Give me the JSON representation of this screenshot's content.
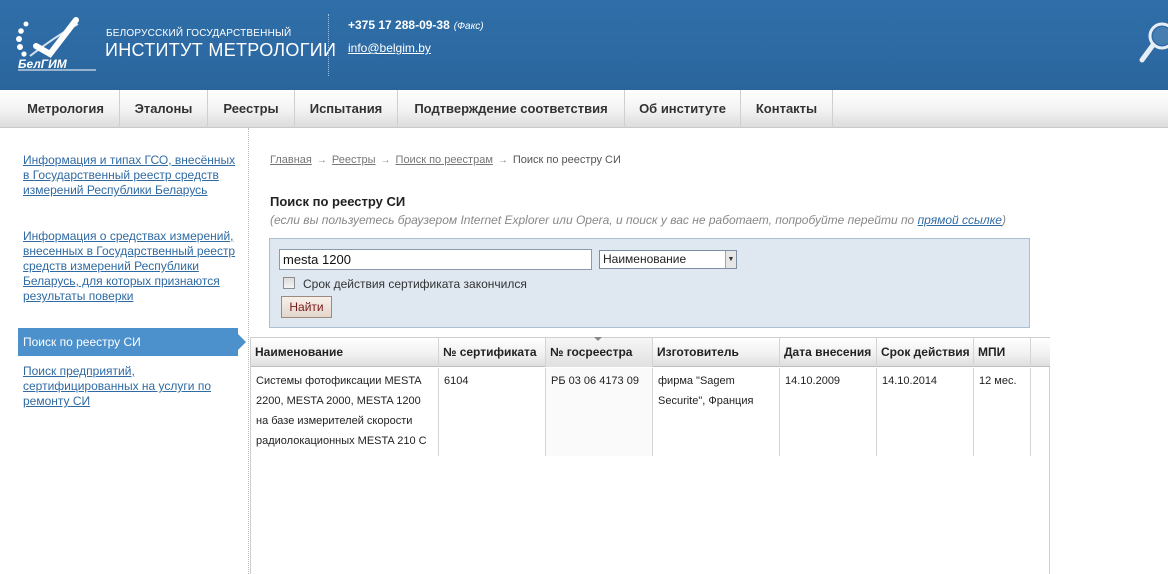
{
  "header": {
    "logo_text": "БелГИМ",
    "org_line1": "БЕЛОРУССКИЙ ГОСУДАРСТВЕННЫЙ",
    "org_line2": "ИНСТИТУТ МЕТРОЛОГИИ",
    "phone": "+375 17 288-09-38",
    "phone_note": "(Факс)",
    "email": "info@belgim.by"
  },
  "nav": {
    "items": [
      {
        "label": "Метрология"
      },
      {
        "label": "Эталоны"
      },
      {
        "label": "Реестры"
      },
      {
        "label": "Испытания"
      },
      {
        "label": "Подтверждение соответствия"
      },
      {
        "label": "Об институте"
      },
      {
        "label": "Контакты"
      }
    ]
  },
  "sidebar": {
    "items": [
      {
        "label": "Информация и типах ГСО, внесённых в Государственный реестр средств измерений Республики Беларусь"
      },
      {
        "label": "Информация о средствах измерений, внесенных в Государственный реестр средств измерений Республики Беларусь, для которых признаются результаты поверки"
      },
      {
        "label": "Поиск по реестру СИ",
        "active": true
      },
      {
        "label": "Поиск предприятий, сертифицированных на услуги по ремонту СИ"
      }
    ]
  },
  "breadcrumb": {
    "items": [
      "Главная",
      "Реестры",
      "Поиск по реестрам"
    ],
    "current": "Поиск по реестру СИ"
  },
  "main": {
    "title": "Поиск по реестру СИ",
    "note_before": "(если вы пользуетесь браузером Internet Explorer или Opera, и поиск у вас не работает, попробуйте перейти по",
    "note_link": "прямой ссылке",
    "note_after": ")"
  },
  "search": {
    "query": "mesta 1200",
    "field_selected": "Наименование",
    "expired_label": "Срок действия сертификата закончился",
    "expired_checked": false,
    "button_label": "Найти"
  },
  "results": {
    "columns": [
      "Наименование",
      "№ сертификата",
      "№ госреестра",
      "Изготовитель",
      "Дата внесения",
      "Срок действия",
      "МПИ"
    ],
    "sorted_column": "№ госреестра",
    "rows": [
      {
        "name": "Системы фотофиксации MESTA 2200, MESTA 2000, MESTA 1200 на базе измерителей скорости радиолокационных MESTA 210 C",
        "certificate": "6104",
        "registry": "РБ 03 06 4173 09",
        "manufacturer": "фирма \"Sagem Securite\", Франция",
        "date_added": "14.10.2009",
        "valid_until": "14.10.2014",
        "mpi": "12 мес."
      }
    ]
  },
  "colors": {
    "header_blue": "#2d6aa3",
    "link_blue": "#2f6aa3",
    "active_item": "#4c90cc",
    "search_panel": "#dfe8f1"
  }
}
